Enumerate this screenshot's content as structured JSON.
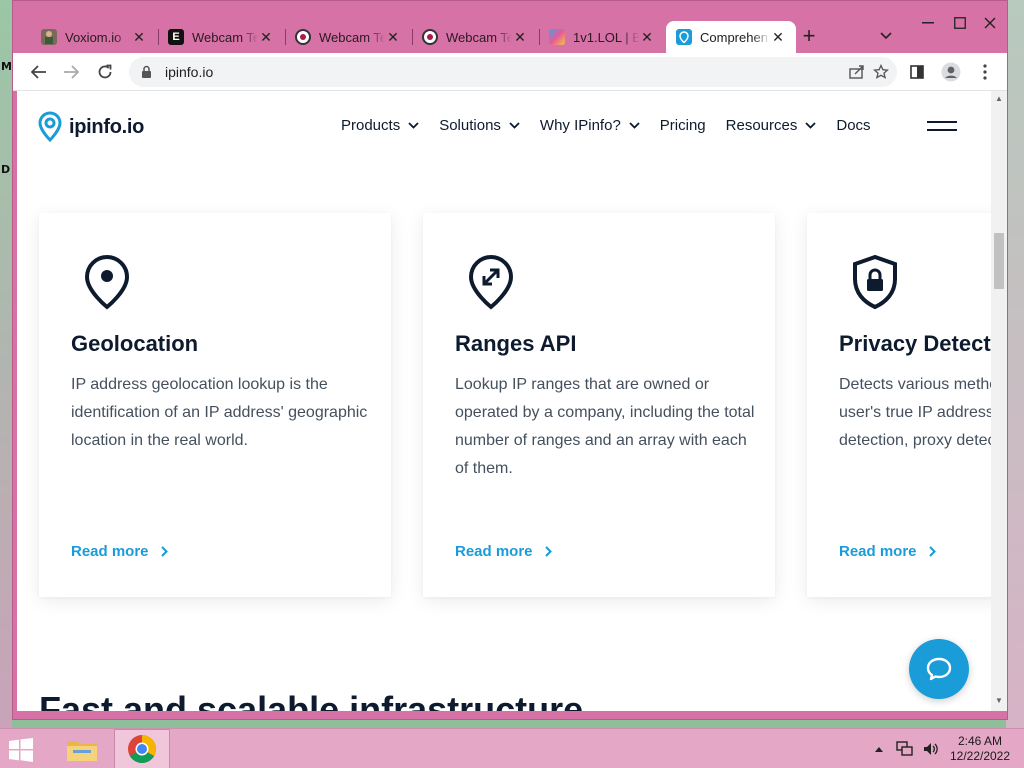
{
  "desktop": {
    "glyph_m": "M",
    "glyph_d": "D"
  },
  "browser": {
    "tabs": [
      {
        "title": "Voxiom.io",
        "favicon": "avatar-figure",
        "active": false
      },
      {
        "title": "Webcam Te",
        "favicon": "letter-e",
        "favicon_text": "E",
        "active": false
      },
      {
        "title": "Webcam Te",
        "favicon": "webcam-dot",
        "active": false
      },
      {
        "title": "Webcam Te",
        "favicon": "webcam-dot",
        "active": false
      },
      {
        "title": "1v1.LOL | B",
        "favicon": "game-art",
        "active": false
      },
      {
        "title": "Comprehen",
        "favicon": "ipinfo-pin",
        "active": true
      }
    ],
    "address": {
      "url": "ipinfo.io"
    }
  },
  "site": {
    "logo_text": "ipinfo.io",
    "nav": [
      {
        "label": "Products",
        "dropdown": true
      },
      {
        "label": "Solutions",
        "dropdown": true
      },
      {
        "label": "Why IPinfo?",
        "dropdown": true
      },
      {
        "label": "Pricing",
        "dropdown": false
      },
      {
        "label": "Resources",
        "dropdown": true
      },
      {
        "label": "Docs",
        "dropdown": false
      }
    ],
    "cards": [
      {
        "icon": "location-pin-icon",
        "title": "Geolocation",
        "description": "IP address geolocation lookup is the identification of an IP address' geographic location in the real world.",
        "link": "Read more"
      },
      {
        "icon": "range-pin-icon",
        "title": "Ranges API",
        "description": "Lookup IP ranges that are owned or operated by a company, including the total number of ranges and an array with each of them.",
        "link": "Read more"
      },
      {
        "icon": "shield-lock-icon",
        "title": "Privacy Detection",
        "description": "Detects various methods used to mask a user's true IP address, including VPN detection, proxy detection and more.",
        "link": "Read more"
      }
    ],
    "section_heading": "Fast and scalable infrastructure"
  },
  "taskbar": {
    "time": "2:46 AM",
    "date": "12/22/2022"
  },
  "colors": {
    "window_frame": "#d672a5",
    "accent": "#1a9cd8",
    "text_dark": "#0e1b2e",
    "taskbar": "#e4a8c6"
  }
}
